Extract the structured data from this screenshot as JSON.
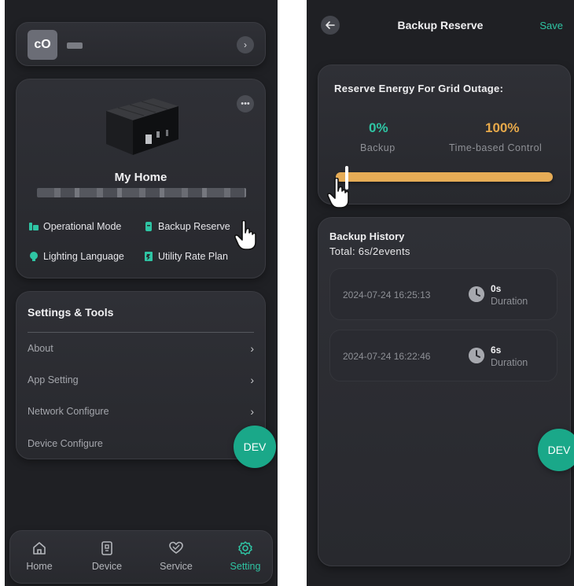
{
  "left": {
    "account": {
      "avatar_text": "cO"
    },
    "home": {
      "name": "My Home",
      "features": [
        {
          "label": "Operational Mode",
          "icon": "operational-mode-icon"
        },
        {
          "label": "Backup Reserve",
          "icon": "backup-reserve-icon"
        },
        {
          "label": "Lighting Language",
          "icon": "lighting-language-icon"
        },
        {
          "label": "Utility Rate Plan",
          "icon": "utility-rate-plan-icon"
        }
      ]
    },
    "settings": {
      "title": "Settings & Tools",
      "rows": [
        {
          "label": "About"
        },
        {
          "label": "App Setting"
        },
        {
          "label": "Network Configure"
        },
        {
          "label": "Device Configure"
        }
      ]
    },
    "dev_label": "DEV",
    "nav": [
      {
        "label": "Home",
        "icon": "home-icon"
      },
      {
        "label": "Device",
        "icon": "device-icon"
      },
      {
        "label": "Service",
        "icon": "service-icon"
      },
      {
        "label": "Setting",
        "icon": "gear-icon",
        "active": true
      }
    ]
  },
  "right": {
    "title": "Backup Reserve",
    "save_label": "Save",
    "reserve": {
      "title": "Reserve Energy For Grid Outage:",
      "backup_pct": "0%",
      "backup_label": "Backup",
      "tbc_pct": "100%",
      "tbc_label": "Time-based Control",
      "slider_value_pct": 0
    },
    "history": {
      "title": "Backup History",
      "total": "Total: 6s/2events",
      "events": [
        {
          "time": "2024-07-24  16:25:13",
          "duration": "0s",
          "duration_label": "Duration"
        },
        {
          "time": "2024-07-24  16:22:46",
          "duration": "6s",
          "duration_label": "Duration"
        }
      ]
    },
    "dev_label": "DEV"
  },
  "colors": {
    "accent_green": "#2fc5a4",
    "accent_orange": "#e7a94a",
    "dev_button": "#1aa889",
    "background": "#1f2024"
  }
}
